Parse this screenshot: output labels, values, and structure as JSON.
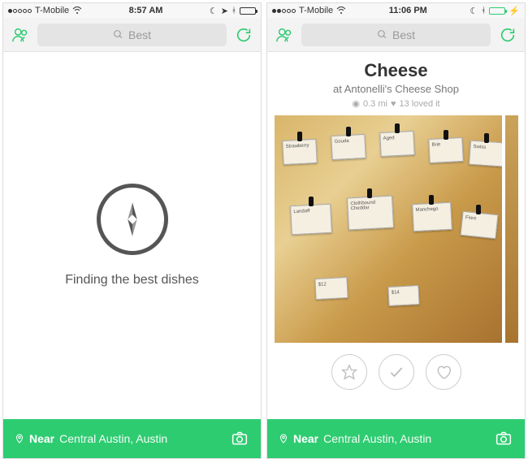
{
  "left": {
    "status": {
      "carrier": "T-Mobile",
      "time": "8:57 AM",
      "signal_filled": 1,
      "battery_pct": 90,
      "battery_charging": false,
      "battery_green": false
    },
    "nav": {
      "search_placeholder": "Best"
    },
    "main": {
      "loading_text": "Finding the best dishes"
    },
    "bottom": {
      "near_label": "Near",
      "location": "Central Austin, Austin"
    }
  },
  "right": {
    "status": {
      "carrier": "T-Mobile",
      "time": "11:06 PM",
      "signal_filled": 2,
      "battery_pct": 70,
      "battery_charging": true,
      "battery_green": true
    },
    "nav": {
      "search_placeholder": "Best"
    },
    "dish": {
      "title": "Cheese",
      "subtitle": "at Antonelli's Cheese Shop",
      "distance": "0.3 mi",
      "loved_count": "13 loved it"
    },
    "bottom": {
      "near_label": "Near",
      "location": "Central Austin, Austin"
    }
  }
}
